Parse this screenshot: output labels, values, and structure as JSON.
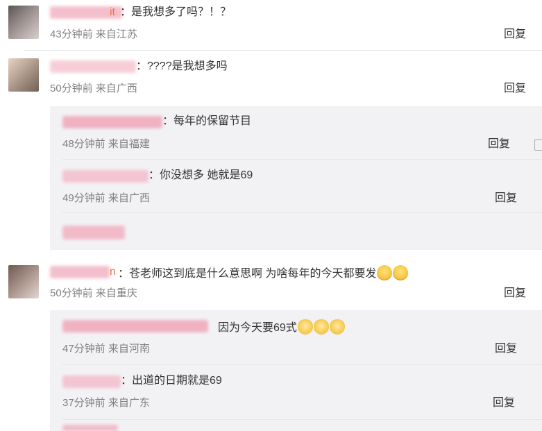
{
  "comments": [
    {
      "text": "：是我想多了吗？！？",
      "name_visible": "it",
      "time": "43分钟前 来自江苏",
      "reply": "回复"
    },
    {
      "text": "：????是我想多吗",
      "time": "50分钟前 来自广西",
      "reply": "回复",
      "replies": [
        {
          "text": "：每年的保留节目",
          "time": "48分钟前 来自福建",
          "reply": "回复"
        },
        {
          "text": "：你没想多 她就是69",
          "time": "49分钟前 来自广西",
          "reply": "回复"
        }
      ]
    },
    {
      "text": "：苍老师这到底是什么意思啊 为啥每年的今天都要发",
      "name_visible": "n",
      "time": "50分钟前 来自重庆",
      "reply": "回复",
      "replies": [
        {
          "text": "因为今天要69式",
          "time": "47分钟前 来自河南",
          "reply": "回复"
        },
        {
          "text": "：出道的日期就是69",
          "time": "37分钟前 来自广东",
          "reply": "回复"
        }
      ]
    }
  ],
  "colors": {
    "blurred_name": "#f0b6c4",
    "meta_text": "#808080",
    "panel_bg": "#f2f2f5"
  },
  "icons": {
    "emoji_smile": "smile-emoji-icon",
    "emoji_cat": "cat-emoji-icon",
    "like": "thumbs-up-icon"
  }
}
